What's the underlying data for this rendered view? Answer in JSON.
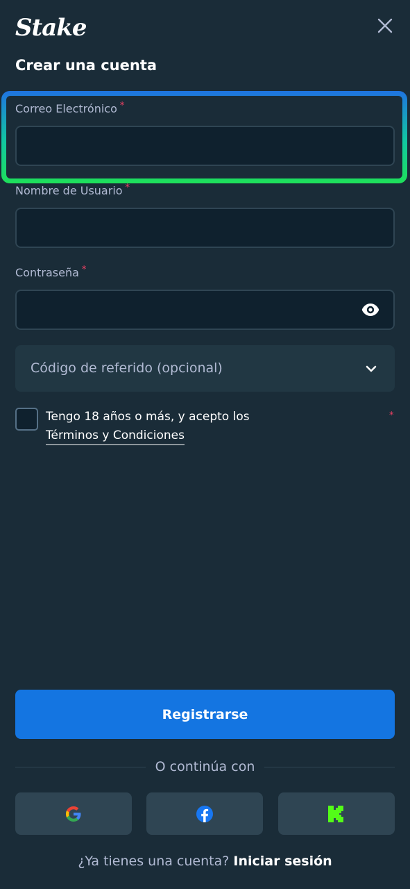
{
  "header": {
    "logo_text": "Stake",
    "title": "Crear una cuenta",
    "close_icon": "close-icon"
  },
  "form": {
    "email": {
      "label": "Correo Electrónico",
      "required_mark": "*",
      "value": ""
    },
    "username": {
      "label": "Nombre de Usuario",
      "required_mark": "*",
      "value": ""
    },
    "password": {
      "label": "Contraseña",
      "required_mark": "*",
      "value": "",
      "toggle_icon": "eye-icon"
    },
    "referral": {
      "label": "Código de referido (opcional)",
      "icon": "chevron-down-icon"
    },
    "terms": {
      "text": "Tengo 18 años o más, y acepto los",
      "link": "Términos y Condiciones",
      "required_mark": "*",
      "checked": false
    },
    "submit_label": "Registrarse"
  },
  "social": {
    "divider_text": "O continúa con",
    "providers": [
      "google-icon",
      "facebook-icon",
      "kick-icon"
    ]
  },
  "footer": {
    "prompt": "¿Ya tienes una cuenta?",
    "login_link": "Iniciar sesión"
  },
  "colors": {
    "background": "#1a2c38",
    "input_bg": "#0f212e",
    "input_border": "#2f4553",
    "accent_blue": "#1475e1",
    "required_red": "#ed4163",
    "highlight_top": "#1f73e0",
    "highlight_bottom": "#1ee05a",
    "kick_green": "#53fc18"
  }
}
